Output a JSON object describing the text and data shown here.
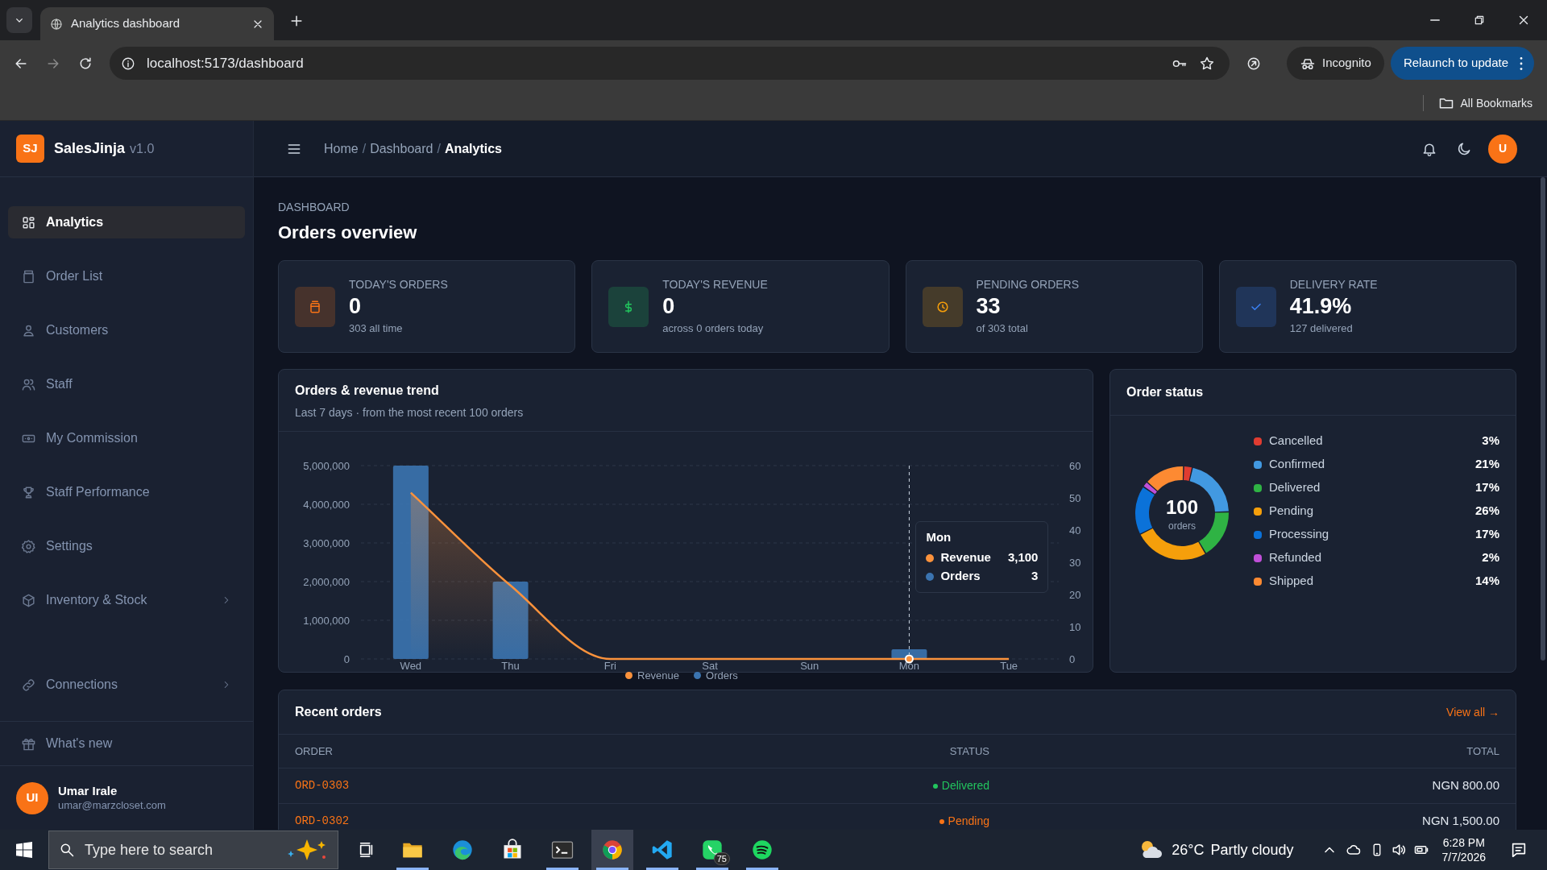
{
  "browser": {
    "tab_title": "Analytics dashboard",
    "url": "localhost:5173/dashboard",
    "profile": "Incognito",
    "update_button": "Relaunch to update",
    "bookmarks": "All Bookmarks"
  },
  "sidebar": {
    "logo": "SJ",
    "brand": "SalesJinja",
    "version": "v1.0",
    "items": [
      {
        "label": "Analytics",
        "kind": "grid",
        "selected": true,
        "expandable": false
      },
      {
        "label": "Order List",
        "kind": "clipboard",
        "selected": false,
        "expandable": false
      },
      {
        "label": "Customers",
        "kind": "user",
        "selected": false,
        "expandable": false
      },
      {
        "label": "Staff",
        "kind": "users",
        "selected": false,
        "expandable": false
      },
      {
        "label": "My Commission",
        "kind": "banknote",
        "selected": false,
        "expandable": false
      },
      {
        "label": "Staff Performance",
        "kind": "trophy",
        "selected": false,
        "expandable": false
      },
      {
        "label": "Settings",
        "kind": "gear",
        "selected": false,
        "expandable": false
      },
      {
        "label": "Inventory & Stock",
        "kind": "cube",
        "selected": false,
        "expandable": true
      },
      {
        "label": "Connections",
        "kind": "link",
        "selected": false,
        "expandable": true
      }
    ],
    "footer_item": "What's new",
    "user": {
      "initials": "UI",
      "name": "Umar Irale",
      "email": "umar@marzcloset.com"
    }
  },
  "header": {
    "breadcrumb": [
      {
        "label": "Home",
        "current": false
      },
      {
        "separator": "/",
        "label": "Dashboard",
        "current": false
      },
      {
        "separator": "/",
        "label": "Analytics",
        "current": true
      }
    ],
    "avatar": "U"
  },
  "page": {
    "eyebrow": "DASHBOARD",
    "title": "Orders overview"
  },
  "stats": [
    {
      "kind": "orders",
      "color": "#f97316",
      "label": "TODAY'S ORDERS",
      "value": "0",
      "note": "303 all time"
    },
    {
      "kind": "revenue",
      "color": "#22c55e",
      "label": "TODAY'S REVENUE",
      "value": "0",
      "note": "across 0 orders today"
    },
    {
      "kind": "pending",
      "color": "#f59e0b",
      "label": "PENDING ORDERS",
      "value": "33",
      "note": "of 303 total"
    },
    {
      "kind": "rate",
      "color": "#3b82f6",
      "label": "DELIVERY RATE",
      "value": "41.9%",
      "note": "127 delivered"
    }
  ],
  "trend": {
    "title": "Orders & revenue trend",
    "subtitle": "Last 7 days · from the most recent 100 orders",
    "hovered": [
      false,
      false,
      false,
      false,
      false,
      true,
      false
    ],
    "chart_data": {
      "type": "bar",
      "categories": [
        "Wed",
        "Thu",
        "Fri",
        "Sat",
        "Sun",
        "Mon",
        "Tue"
      ],
      "series": [
        {
          "name": "Revenue",
          "type": "area",
          "color": "#fb923c",
          "values": [
            4300000,
            1900000,
            0,
            0,
            0,
            0,
            0
          ]
        },
        {
          "name": "Orders",
          "type": "bar",
          "axis": "y2",
          "color": "#3b74b0",
          "values": [
            60,
            24,
            0,
            0,
            0,
            3,
            0
          ]
        }
      ],
      "ylim": [
        0,
        5000000
      ],
      "yticks": [
        {
          "value": 0,
          "label": "0"
        },
        {
          "value": 1000000,
          "label": "1,000,000"
        },
        {
          "value": 2000000,
          "label": "2,000,000"
        },
        {
          "value": 3000000,
          "label": "3,000,000"
        },
        {
          "value": 4000000,
          "label": "4,000,000"
        },
        {
          "value": 5000000,
          "label": "5,000,000"
        }
      ],
      "grid": true,
      "ref_lines": [
        {
          "axis": "x",
          "value": "Mon",
          "color": "#cbd5e1"
        }
      ],
      "y2lim": [
        0,
        60
      ],
      "y2ticks": [
        0,
        10,
        20,
        30,
        40,
        50,
        60
      ]
    },
    "tooltip": {
      "title": "Mon",
      "rows": [
        {
          "label": "Revenue",
          "value": "3,100"
        },
        {
          "label": "Orders",
          "value": "3"
        }
      ]
    }
  },
  "status": {
    "title": "Order status",
    "center_value": "100",
    "center_label": "orders",
    "chart_data": {
      "type": "donut",
      "categories": [
        "Cancelled",
        "Confirmed",
        "Delivered",
        "Pending",
        "Processing",
        "Refunded",
        "Shipped"
      ],
      "values": [
        3,
        21,
        17,
        26,
        17,
        2,
        14
      ]
    },
    "items": [
      {
        "color": "#e03c31",
        "percent": "3%"
      },
      {
        "color": "#4299e1",
        "percent": "21%"
      },
      {
        "color": "#2fb344",
        "percent": "17%"
      },
      {
        "color": "#f59f0b",
        "percent": "26%"
      },
      {
        "color": "#0b72d9",
        "percent": "17%"
      },
      {
        "color": "#c04fd8",
        "percent": "2%"
      },
      {
        "color": "#fd8a32",
        "percent": "14%"
      }
    ]
  },
  "recent": {
    "title": "Recent orders",
    "link": "View all →",
    "columns": [
      "ORDER",
      "STATUS",
      "TOTAL"
    ],
    "rows": [
      {
        "order": "ORD-0303",
        "status": "Delivered",
        "color": "#22c55e",
        "total": "NGN 800.00"
      },
      {
        "order": "ORD-0302",
        "status": "Pending",
        "color": "#f97316",
        "total": "NGN 1,500.00"
      }
    ]
  },
  "taskbar": {
    "search_placeholder": "Type here to search",
    "apps": [
      {
        "kind": "files",
        "running": true,
        "selected": false
      },
      {
        "kind": "edge",
        "running": false,
        "selected": false
      },
      {
        "kind": "store",
        "running": false,
        "selected": false
      },
      {
        "kind": "terminal",
        "running": true,
        "selected": false
      },
      {
        "kind": "chrome",
        "running": true,
        "selected": true
      },
      {
        "kind": "code",
        "running": true,
        "selected": false
      },
      {
        "kind": "chat",
        "running": true,
        "selected": false,
        "badge": "75"
      },
      {
        "kind": "music",
        "running": true,
        "selected": false
      }
    ],
    "temperature": "26°C",
    "weather": "Partly cloudy",
    "time": "6:28 PM",
    "date": "7/7/2026"
  }
}
